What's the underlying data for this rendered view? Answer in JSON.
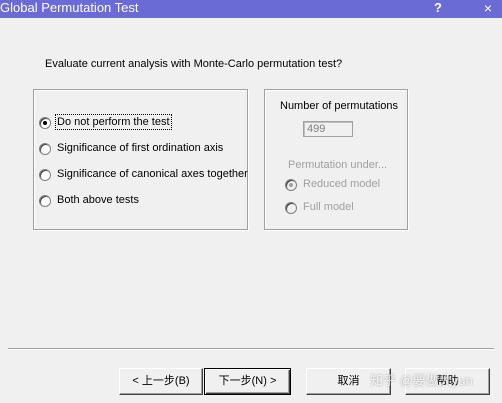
{
  "window": {
    "title": "Global Permutation Test",
    "help_glyph": "?",
    "close_glyph": "×"
  },
  "prompt": "Evaluate current analysis with Monte-Carlo permutation test?",
  "test_options": [
    {
      "label": "Do not perform the test",
      "checked": true
    },
    {
      "label": "Significance of first ordination axis",
      "checked": false
    },
    {
      "label": "Significance of canonical axes together",
      "checked": false
    },
    {
      "label": "Both above tests",
      "checked": false
    }
  ],
  "permutations": {
    "label": "Number of permutations",
    "value": "499",
    "under_label": "Permutation under...",
    "options": [
      {
        "label": "Reduced model",
        "checked": true,
        "disabled": true
      },
      {
        "label": "Full model",
        "checked": false,
        "disabled": true
      }
    ]
  },
  "buttons": {
    "back": "< 上一步(B)",
    "next": "下一步(N) >",
    "cancel": "取消",
    "help": "帮助"
  },
  "watermark": "知乎 @要做大yun",
  "colors": {
    "titlebar": "#6b6bd6",
    "dialog_bg": "#f0f0f0",
    "disabled_text": "#a0a0a0"
  }
}
